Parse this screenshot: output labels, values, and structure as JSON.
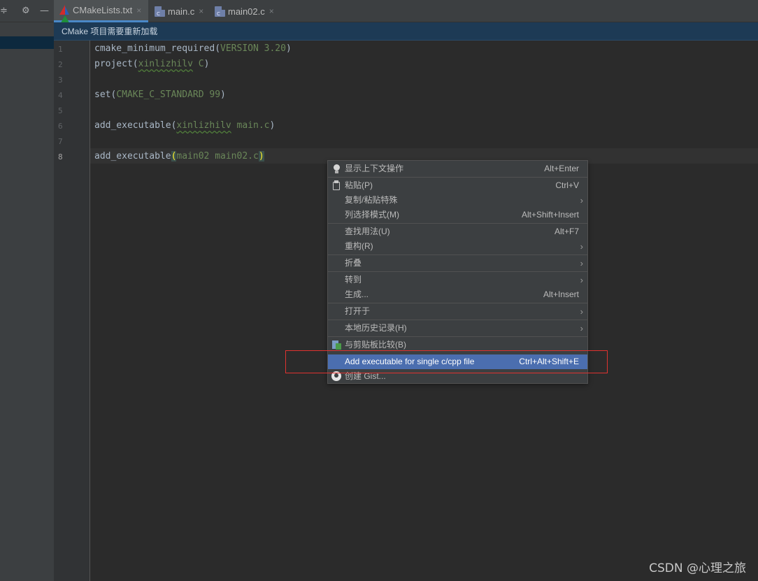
{
  "left_toolbar": {
    "icons": [
      "collapse-icon",
      "gear-icon",
      "minimize-icon"
    ]
  },
  "tabs": [
    {
      "label": "CMakeLists.txt",
      "icon": "cmake-icon",
      "active": true
    },
    {
      "label": "main.c",
      "icon": "c-file-icon",
      "active": false
    },
    {
      "label": "main02.c",
      "icon": "c-file-icon",
      "active": false
    }
  ],
  "tab_close_glyph": "×",
  "c_icon_letter": "C",
  "notification": "CMake 项目需要重新加载",
  "editor": {
    "current_line": 8,
    "line_numbers": [
      "1",
      "2",
      "3",
      "4",
      "5",
      "6",
      "7",
      "8"
    ],
    "lines": [
      {
        "fn": "cmake_minimum_required",
        "open": "(",
        "args": "VERSION 3.20",
        "close": ")"
      },
      {
        "fn": "project",
        "open": "(",
        "args_wavy": "xinlizhilv",
        "args": " C",
        "close": ")"
      },
      {
        "fn": "",
        "open": "",
        "args": "",
        "close": ""
      },
      {
        "fn": "set",
        "open": "(",
        "args": "CMAKE_C_STANDARD 99",
        "close": ")"
      },
      {
        "fn": "",
        "open": "",
        "args": "",
        "close": ""
      },
      {
        "fn": "add_executable",
        "open": "(",
        "args_wavy": "xinlizhilv",
        "args": " main.c",
        "close": ")"
      },
      {
        "fn": "",
        "open": "",
        "args": "",
        "close": ""
      },
      {
        "fn": "add_executable",
        "open": "(",
        "args": "main02 main02.c",
        "close": ")"
      }
    ]
  },
  "context_menu": {
    "items": [
      {
        "label": "显示上下文操作",
        "shortcut": "Alt+Enter",
        "icon": "lightbulb-icon"
      },
      {
        "label": "粘贴(P)",
        "shortcut": "Ctrl+V",
        "icon": "clipboard-icon"
      },
      {
        "label": "复制/粘贴特殊",
        "submenu": true
      },
      {
        "label": "列选择模式(M)",
        "shortcut": "Alt+Shift+Insert"
      },
      {
        "label": "查找用法(U)",
        "shortcut": "Alt+F7"
      },
      {
        "label": "重构(R)",
        "submenu": true
      },
      {
        "label": "折叠",
        "submenu": true
      },
      {
        "label": "转到",
        "submenu": true
      },
      {
        "label": "生成...",
        "shortcut": "Alt+Insert"
      },
      {
        "label": "打开于",
        "submenu": true
      },
      {
        "label": "本地历史记录(H)",
        "submenu": true
      },
      {
        "label": "与剪贴板比较(B)",
        "icon": "compare-clipboard-icon"
      },
      {
        "label": "Add executable for single c/cpp file",
        "shortcut": "Ctrl+Alt+Shift+E",
        "highlighted": true
      },
      {
        "label": "创建 Gist...",
        "icon": "github-icon"
      }
    ],
    "submenu_glyph": "›"
  },
  "watermark": "CSDN @心理之旅",
  "colors": {
    "editor_bg": "#2b2b2b",
    "menu_highlight": "#4b6eaf",
    "annotation_box": "#e0322f",
    "string_arg": "#6a8759"
  }
}
